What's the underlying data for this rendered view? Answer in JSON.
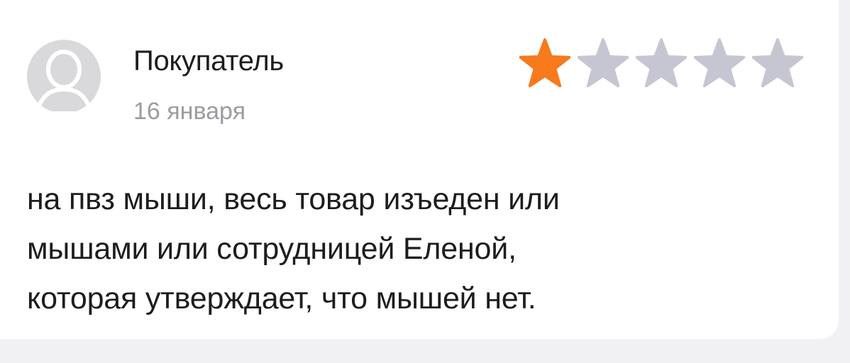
{
  "review": {
    "author": "Покупатель",
    "date": "16 января",
    "rating": 1,
    "max_rating": 5,
    "text_lines": [
      "на пвз мыши, весь товар изъеден или",
      "мышами или сотрудницей Еленой,",
      "которая утверждает, что мышей нет."
    ]
  },
  "colors": {
    "star_filled": "#f77a1c",
    "star_empty": "#c6c6d3",
    "avatar_bg": "#d9d9db",
    "avatar_fg": "#ffffff",
    "date_text": "#9b9ba1"
  },
  "icons": {
    "avatar": "user-silhouette-icon",
    "star": "star-icon"
  }
}
